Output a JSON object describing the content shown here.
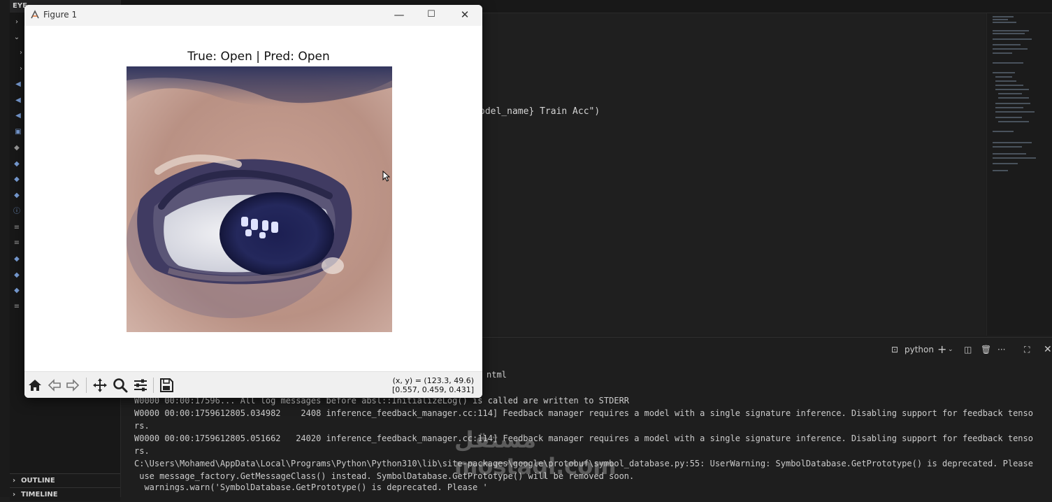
{
  "sidebar": {
    "top_label": "EYE",
    "sections": [
      {
        "label": "OUTLINE"
      },
      {
        "label": "TIMELINE"
      }
    ]
  },
  "editor": {
    "visible_code": "odel_name} Train Acc\")"
  },
  "terminal": {
    "tab_label": "python",
    "partial_line": "ntml",
    "lines": [
      "W0000 00:00:17596... All log messages before absl::InitializeLog() is called are written to STDERR",
      "W0000 00:00:1759612805.034982    2408 inference_feedback_manager.cc:114] Feedback manager requires a model with a single signature inference. Disabling support for feedback tenso",
      "rs.",
      "W0000 00:00:1759612805.051662   24020 inference_feedback_manager.cc:114] Feedback manager requires a model with a single signature inference. Disabling support for feedback tenso",
      "rs.",
      "C:\\Users\\Mohamed\\AppData\\Local\\Programs\\Python\\Python310\\lib\\site-packages\\google\\protobuf\\symbol_database.py:55: UserWarning: SymbolDatabase.GetPrototype() is deprecated. Please",
      " use message_factory.GetMessageClass() instead. SymbolDatabase.GetPrototype() will be removed soon.",
      "  warnings.warn('SymbolDatabase.GetPrototype() is deprecated. Please '"
    ]
  },
  "figure": {
    "window_title": "Figure 1",
    "plot_title": "True: Open | Pred: Open",
    "coords_line1": "(x, y) = (123.3, 49.6)",
    "coords_line2": "[0.557, 0.459, 0.431]",
    "toolbar_icons": [
      "home-icon",
      "back-icon",
      "forward-icon",
      "pan-icon",
      "zoom-icon",
      "configure-icon",
      "save-icon"
    ]
  },
  "watermark": {
    "text": "مستقل mostaql.com"
  }
}
